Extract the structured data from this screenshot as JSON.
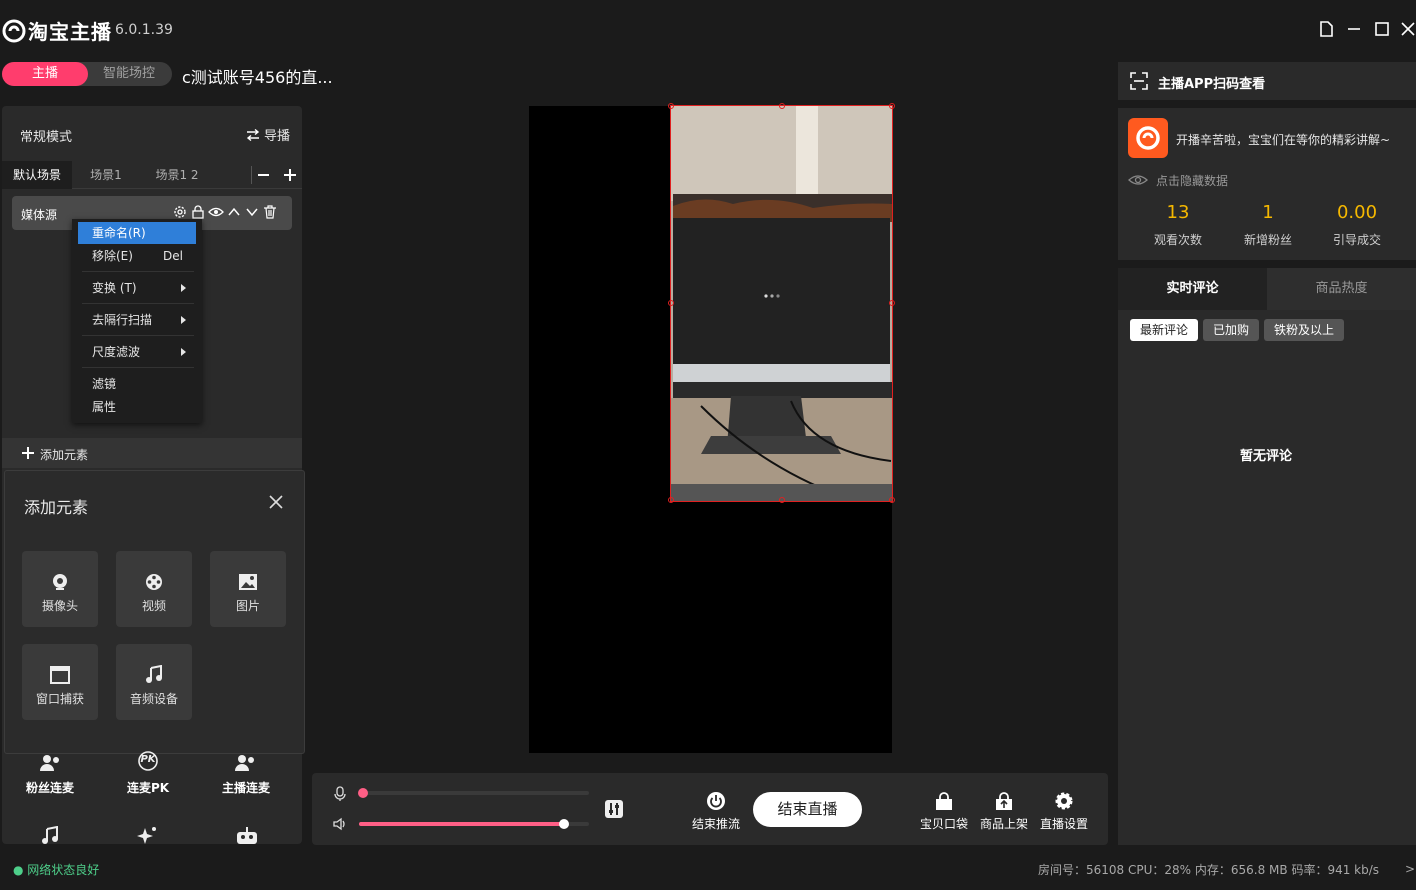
{
  "app": {
    "title": "淘宝主播",
    "version": "6.0.1.39"
  },
  "mode_toggle": {
    "anchor": "主播",
    "smart": "智能场控"
  },
  "stream_title": "c测试账号456的直...",
  "left": {
    "mode_label": "常规模式",
    "guide": "导播",
    "scenes": [
      "默认场景",
      "场景1",
      "场景1 2"
    ],
    "source": "媒体源",
    "add_element": "添加元素"
  },
  "context_menu": {
    "rename": "重命名(R)",
    "remove": "移除(E)",
    "remove_shortcut": "Del",
    "transform": "变换 (T)",
    "deinterlace": "去隔行扫描",
    "scale_filter": "尺度滤波",
    "filters": "滤镜",
    "properties": "属性"
  },
  "add_popup": {
    "title": "添加元素",
    "tiles": [
      "摄像头",
      "视频",
      "图片",
      "窗口捕获",
      "音频设备"
    ]
  },
  "features": [
    "粉丝连麦",
    "连麦PK",
    "主播连麦"
  ],
  "pk_badge": "PK",
  "controls": {
    "end_stream": "结束推流",
    "end_live": "结束直播",
    "bag": "宝贝口袋",
    "shelf": "商品上架",
    "settings": "直播设置",
    "mic_level": 0.0,
    "volume_level": 0.89
  },
  "right": {
    "scan": "主播APP扫码查看",
    "greeting": "开播辛苦啦，宝宝们在等你的精彩讲解~",
    "hide_data": "点击隐藏数据",
    "stats": [
      {
        "value": "13",
        "label": "观看次数"
      },
      {
        "value": "1",
        "label": "新增粉丝"
      },
      {
        "value": "0.00",
        "label": "引导成交"
      }
    ],
    "tabs": [
      "实时评论",
      "商品热度"
    ],
    "chips": [
      "最新评论",
      "已加购",
      "铁粉及以上"
    ],
    "empty": "暂无评论"
  },
  "status": {
    "network": "● 网络状态良好",
    "details": "房间号：56108   CPU：28%   内存：656.8 MB   码率：941 kb/s",
    "arrow": ">"
  },
  "colors": {
    "accent": "#ff3d6d",
    "stat": "#f5b800",
    "selection": "#2f7fd9"
  }
}
